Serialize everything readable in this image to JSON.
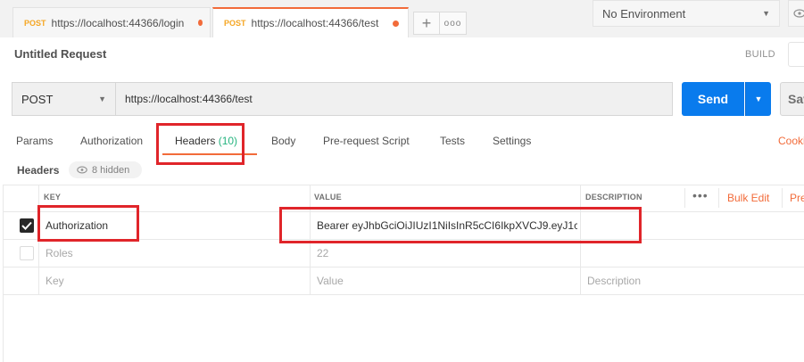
{
  "tabs": [
    {
      "method": "POST",
      "url": "https://localhost:44366/login",
      "active": false
    },
    {
      "method": "POST",
      "url": "https://localhost:44366/test",
      "active": true
    }
  ],
  "tabbar": {
    "new_tab": "+",
    "more": "ooo"
  },
  "environment": {
    "selected": "No Environment"
  },
  "request": {
    "title": "Untitled Request",
    "build_label": "BUILD",
    "method": "POST",
    "url": "https://localhost:44366/test",
    "send_label": "Send",
    "save_label": "Sav"
  },
  "request_tabs": {
    "params": "Params",
    "authorization": "Authorization",
    "headers": "Headers",
    "headers_count": "(10)",
    "body": "Body",
    "prerequest": "Pre-request Script",
    "tests": "Tests",
    "settings": "Settings",
    "cookies": "Cooki"
  },
  "headers_panel": {
    "label": "Headers",
    "hidden_text": "8 hidden",
    "columns": {
      "key": "KEY",
      "value": "VALUE",
      "description": "DESCRIPTION"
    },
    "more": "•••",
    "bulk_edit": "Bulk Edit",
    "presets": "Pre",
    "rows": [
      {
        "key": "Authorization",
        "value": "Bearer eyJhbGciOiJIUzI1NiIsInR5cCI6IkpXVCJ9.eyJ1c...",
        "description": "",
        "enabled": true
      },
      {
        "key": "Roles",
        "value": "22",
        "description": "",
        "enabled": false
      }
    ],
    "placeholder": {
      "key": "Key",
      "value": "Value",
      "description": "Description"
    }
  },
  "colors": {
    "accent": "#f26b3a",
    "send": "#097bed",
    "count": "#26b47f",
    "annotation": "#e0252a"
  }
}
